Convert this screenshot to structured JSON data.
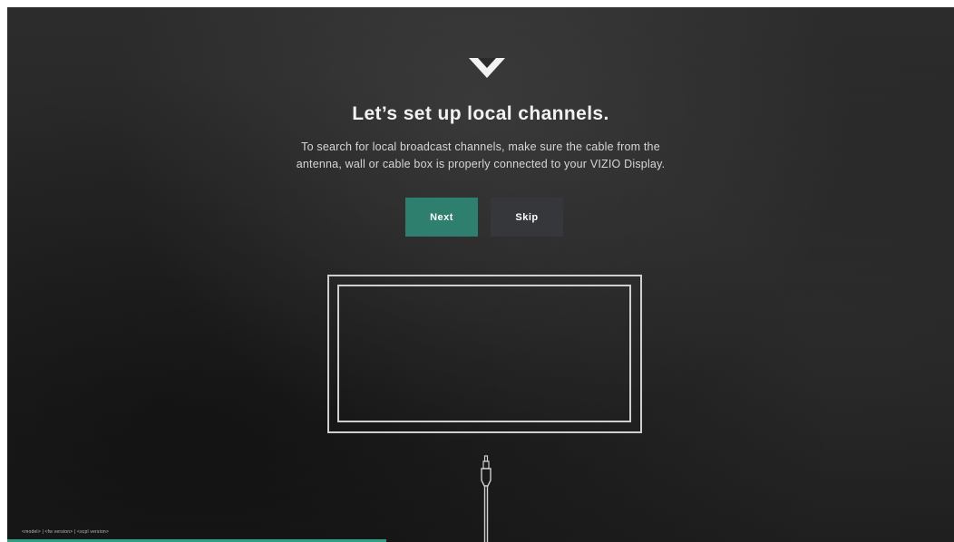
{
  "brand": {
    "logo_icon": "vizio-v-logo-icon",
    "accent_color": "#2e7f6d"
  },
  "heading": {
    "title": "Let’s set up local channels.",
    "description_line1": "To search for local broadcast channels, make sure the cable from the",
    "description_line2": "antenna, wall or cable box is properly connected to your VIZIO Display."
  },
  "actions": {
    "next_label": "Next",
    "skip_label": "Skip"
  },
  "illustration": {
    "tv_icon": "tv-outline-icon",
    "cable_icon": "coax-cable-icon"
  },
  "footer": {
    "model": "<model>",
    "separator": "|",
    "fw_version": "<fw version>",
    "scpl_version": "<scpl version>",
    "progress_fraction": 0.4
  }
}
